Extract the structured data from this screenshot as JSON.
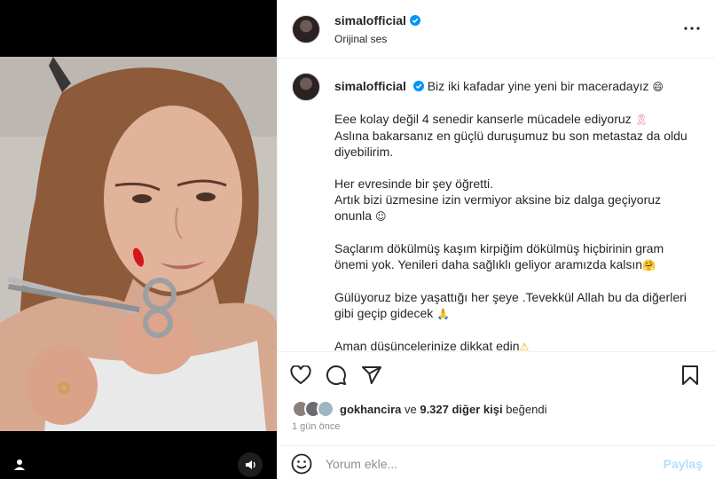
{
  "post": {
    "username": "simalofficial",
    "audio_label": "Orijinal ses",
    "caption_intro": "Biz iki kafadar yine yeni bir maceradayız",
    "caption_lines": [
      [
        "Eee kolay değil 4 senedir kanserle mücadele ediyoruz",
        "Aslına bakarsanız en güçlü duruşumuz bu son metastaz da oldu diyebilirim."
      ],
      [
        "Her evresinde bir şey öğretti.",
        "Artık bizi üzmesine izin vermiyor aksine biz dalga geçiyoruz onunla"
      ],
      [
        "Saçlarım dökülmüş kaşım kirpiğim dökülmüş hiçbirinin gram önemi yok. Yenileri daha sağlıklı geliyor aramızda kalsın"
      ],
      [
        "Gülüyoruz bize yaşattığı her şeye .Tevekkül Allah bu da diğerleri gibi geçip gidecek"
      ],
      [
        "Aman düşüncelerinize dikkat edin"
      ]
    ],
    "emojis": {
      "intro": "😄",
      "ribbon": "🎗",
      "smile": "☺",
      "hug": "🤗",
      "pray": "🙏",
      "warning": "⚠"
    },
    "likes": {
      "user": "gokhancira",
      "connector": "ve",
      "others": "9.327 diğer kişi",
      "suffix": "beğendi"
    },
    "time_ago": "1 gün önce",
    "comment_placeholder": "Yorum ekle...",
    "post_button": "Paylaş"
  },
  "colors": {
    "verified": "#0095f6",
    "post_button_disabled": "#b2dffc",
    "muted": "#8e8e8e"
  },
  "icons": [
    "verified-icon",
    "more-options-icon",
    "heart-icon",
    "comment-icon",
    "share-icon",
    "bookmark-icon",
    "emoji-icon",
    "user-tag-icon",
    "audio-icon"
  ]
}
